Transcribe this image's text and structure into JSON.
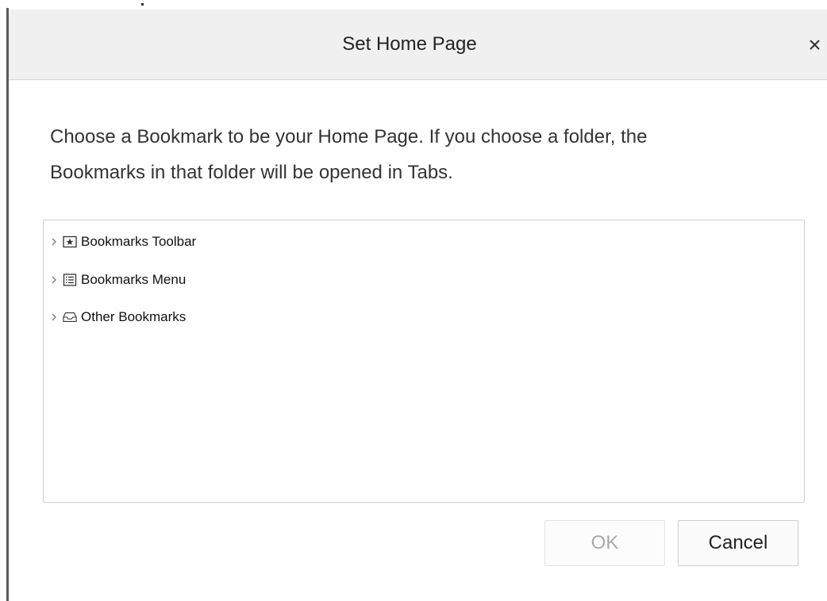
{
  "dialog": {
    "title": "Set Home Page",
    "close_icon": "close-icon"
  },
  "description": {
    "line1": "Choose a Bookmark to be your Home Page. If you choose a folder, the",
    "line2": "Bookmarks in that folder will be opened in Tabs."
  },
  "tree": {
    "items": [
      {
        "label": "Bookmarks Toolbar",
        "icon": "bookmarks-toolbar-icon",
        "expanded": false
      },
      {
        "label": "Bookmarks Menu",
        "icon": "bookmarks-menu-icon",
        "expanded": false
      },
      {
        "label": "Other Bookmarks",
        "icon": "other-bookmarks-icon",
        "expanded": false
      }
    ]
  },
  "buttons": {
    "ok_label": "OK",
    "ok_enabled": false,
    "cancel_label": "Cancel"
  }
}
